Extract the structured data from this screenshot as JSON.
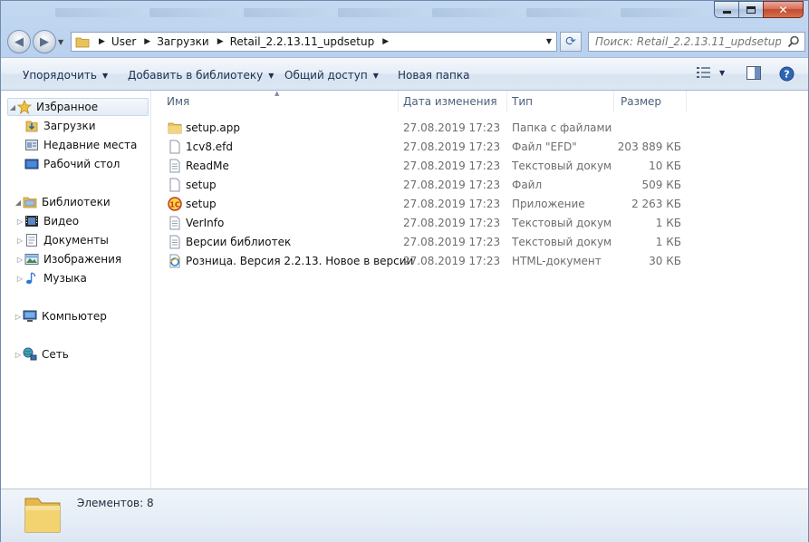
{
  "titlebar": {
    "buttons": {
      "minimize": "minimize",
      "maximize": "maximize",
      "close": "close"
    }
  },
  "address": {
    "crumbs": [
      "User",
      "Загрузки",
      "Retail_2.2.13.11_updsetup"
    ]
  },
  "search": {
    "placeholder": "Поиск: Retail_2.2.13.11_updsetup"
  },
  "toolbar": {
    "organize": "Упорядочить",
    "add_to_library": "Добавить в библиотеку",
    "share": "Общий доступ",
    "new_folder": "Новая папка"
  },
  "sidebar": {
    "favorites": "Избранное",
    "fav_items": [
      "Загрузки",
      "Недавние места",
      "Рабочий стол"
    ],
    "libraries": "Библиотеки",
    "lib_items": [
      "Видео",
      "Документы",
      "Изображения",
      "Музыка"
    ],
    "computer": "Компьютер",
    "network": "Сеть"
  },
  "columns": {
    "name": "Имя",
    "date": "Дата изменения",
    "type": "Тип",
    "size": "Размер"
  },
  "files": [
    {
      "name": "setup.app",
      "date": "27.08.2019 17:23",
      "type": "Папка с файлами",
      "size": "",
      "icon": "folder-icon"
    },
    {
      "name": "1cv8.efd",
      "date": "27.08.2019 17:23",
      "type": "Файл \"EFD\"",
      "size": "203 889 КБ",
      "icon": "file-icon"
    },
    {
      "name": "ReadMe",
      "date": "27.08.2019 17:23",
      "type": "Текстовый докум...",
      "size": "10 КБ",
      "icon": "text-file-icon"
    },
    {
      "name": "setup",
      "date": "27.08.2019 17:23",
      "type": "Файл",
      "size": "509 КБ",
      "icon": "file-icon"
    },
    {
      "name": "setup",
      "date": "27.08.2019 17:23",
      "type": "Приложение",
      "size": "2 263 КБ",
      "icon": "1c-app-icon"
    },
    {
      "name": "VerInfo",
      "date": "27.08.2019 17:23",
      "type": "Текстовый докум...",
      "size": "1 КБ",
      "icon": "text-file-icon"
    },
    {
      "name": "Версии библиотек",
      "date": "27.08.2019 17:23",
      "type": "Текстовый докум...",
      "size": "1 КБ",
      "icon": "text-file-icon"
    },
    {
      "name": "Розница. Версия 2.2.13. Новое в версии",
      "date": "27.08.2019 17:23",
      "type": "HTML-документ",
      "size": "30 КБ",
      "icon": "ie-html-icon"
    }
  ],
  "status": {
    "items_text": "Элементов: 8"
  },
  "colors": {
    "accent": "#3a6ea8",
    "folder": "#e8c35a",
    "selection": "#e4ecf6"
  }
}
